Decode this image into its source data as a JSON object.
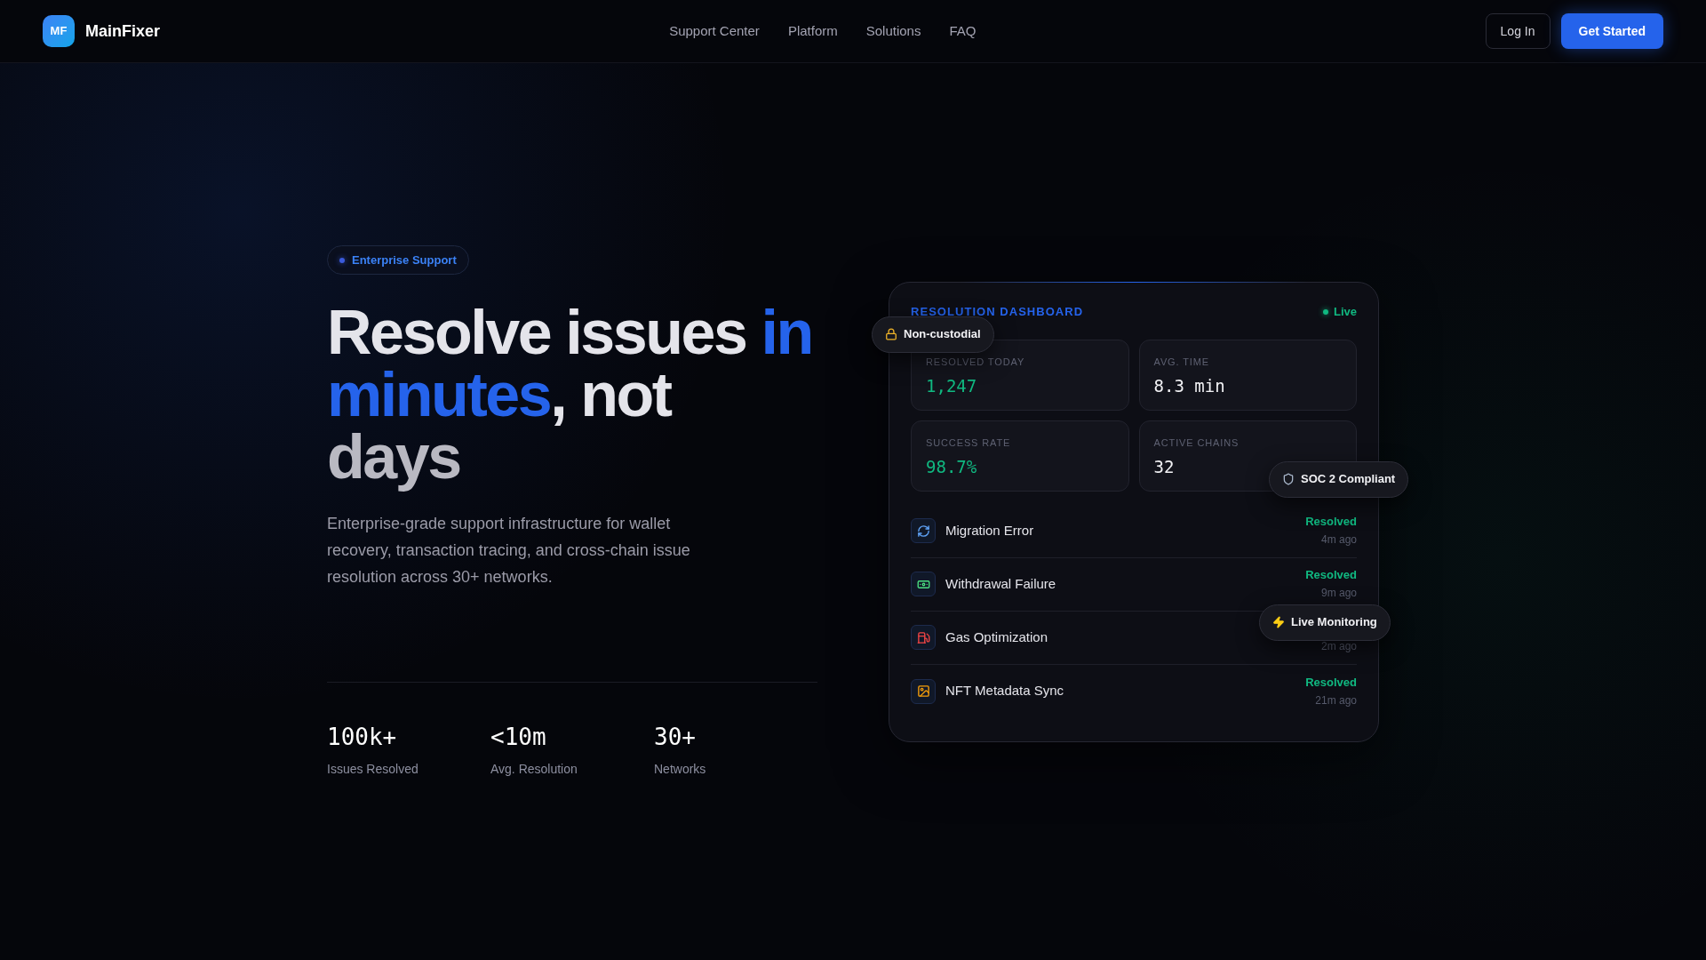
{
  "nav": {
    "logo_mark": "MF",
    "brand": "MainFixer",
    "links": [
      {
        "label": "Support Center"
      },
      {
        "label": "Platform"
      },
      {
        "label": "Solutions"
      },
      {
        "label": "FAQ"
      }
    ],
    "login": "Log In",
    "cta": "Get Started"
  },
  "hero": {
    "badge": "Enterprise Support",
    "heading_lines": [
      [
        {
          "text": "Resolve issues ",
          "highlight": false
        },
        {
          "text": "in",
          "highlight": true
        }
      ],
      [
        {
          "text": "minutes",
          "highlight": true
        },
        {
          "text": ", not",
          "highlight": false
        }
      ],
      [
        {
          "text": "days",
          "highlight": false
        }
      ]
    ],
    "description": "Enterprise-grade support infrastructure for wallet recovery, transaction tracing, and cross-chain issue resolution across 30+ networks.",
    "stats": [
      {
        "value": "100k+",
        "label": "Issues Resolved"
      },
      {
        "value": "<10m",
        "label": "Avg. Resolution"
      },
      {
        "value": "30+",
        "label": "Networks"
      }
    ]
  },
  "dashboard": {
    "title": "RESOLUTION DASHBOARD",
    "status": "Live",
    "metrics": [
      {
        "label": "RESOLVED TODAY",
        "value": "1,247",
        "accent": true
      },
      {
        "label": "AVG. TIME",
        "value": "8.3 min",
        "accent": false
      },
      {
        "label": "SUCCESS RATE",
        "value": "98.7%",
        "accent": true
      },
      {
        "label": "ACTIVE CHAINS",
        "value": "32",
        "accent": false
      }
    ],
    "issues": [
      {
        "kind": "migration",
        "name": "Migration Error",
        "status": "Resolved",
        "time": "4m ago"
      },
      {
        "kind": "withdrawal",
        "name": "Withdrawal Failure",
        "status": "Resolved",
        "time": "9m ago"
      },
      {
        "kind": "gas",
        "name": "Gas Optimization",
        "time": "2m ago"
      },
      {
        "kind": "nft",
        "name": "NFT Metadata Sync",
        "status": "Resolved",
        "time": "21m ago"
      }
    ],
    "floating_badges": [
      {
        "kind": "lock",
        "label": "Non-custodial"
      },
      {
        "kind": "shield",
        "label": "SOC 2 Compliant"
      },
      {
        "kind": "bolt",
        "label": "Live Monitoring"
      }
    ]
  }
}
